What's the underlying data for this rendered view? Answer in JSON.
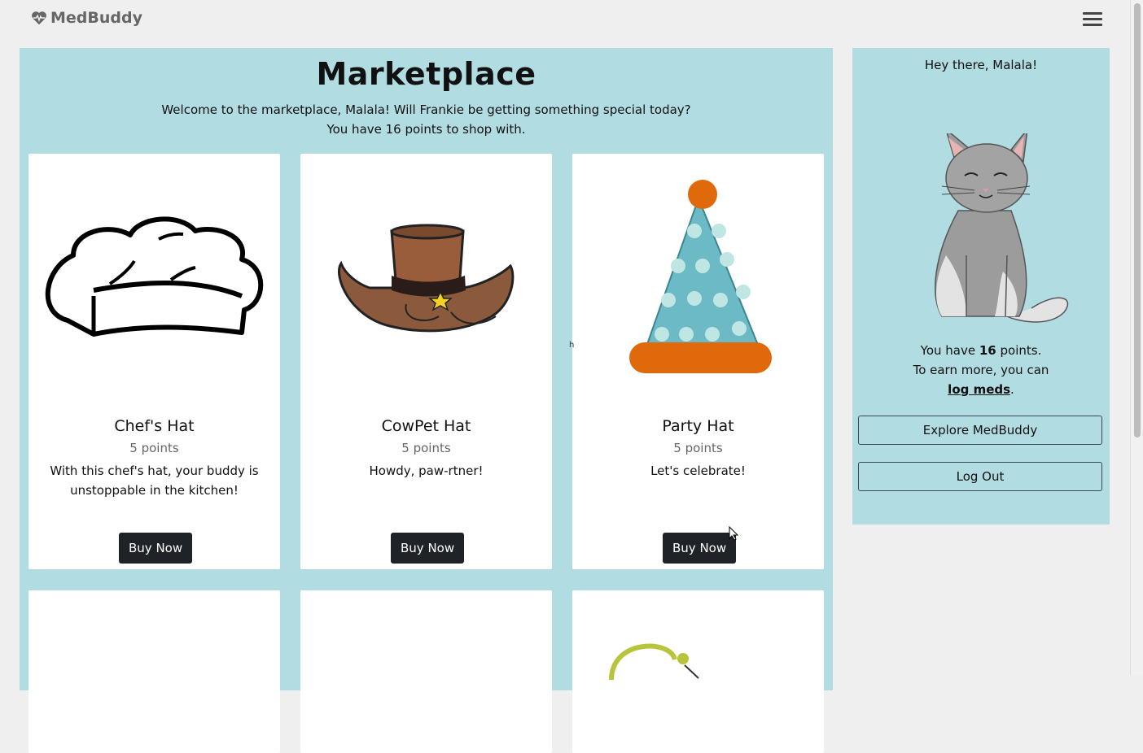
{
  "brand": {
    "name": "MedBuddy",
    "icon": "heart-pulse-icon"
  },
  "nav": {
    "menu_icon": "hamburger-menu-icon"
  },
  "market": {
    "title": "Marketplace",
    "welcome": "Welcome to the marketplace, Malala! Will Frankie be getting something special today?",
    "points_line": "You have 16 points to shop with."
  },
  "items": [
    {
      "name": "Chef's Hat",
      "points": "5 points",
      "description": "With this chef's hat, your buddy is unstoppable in the kitchen!",
      "button": "Buy Now"
    },
    {
      "name": "CowPet Hat",
      "points": "5 points",
      "description": "Howdy, paw-rtner!",
      "button": "Buy Now"
    },
    {
      "name": "Party Hat",
      "points": "5 points",
      "description": "Let's celebrate!",
      "button": "Buy Now"
    }
  ],
  "side": {
    "greeting": "Hey there, Malala!",
    "points_prefix": "You have ",
    "points_value": "16",
    "points_suffix": " points.",
    "earn_text": "To earn more, you can",
    "log_link": "log meds",
    "period": ".",
    "explore_button": "Explore MedBuddy",
    "logout_button": "Log Out"
  },
  "stray_text": "h",
  "colors": {
    "panel": "#b1dce2",
    "background": "#efefef",
    "button_dark": "#1f2327"
  }
}
